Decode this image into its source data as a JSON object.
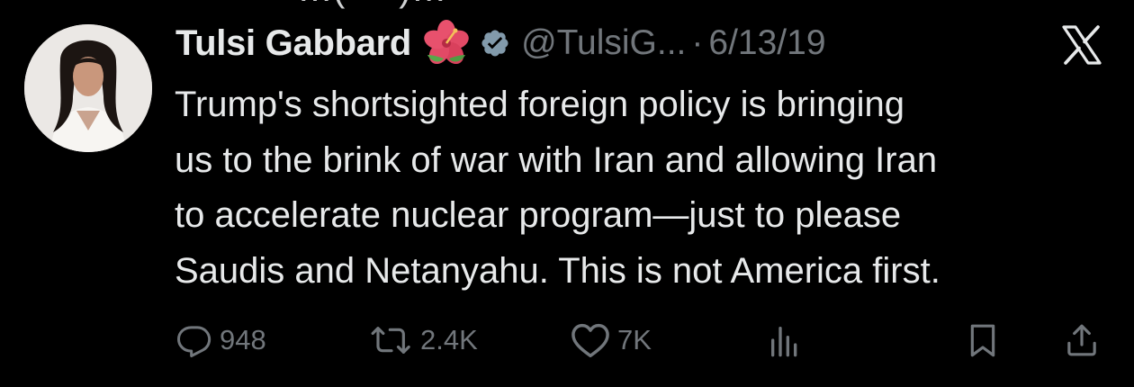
{
  "top_partial_text": "…( ˙ˑ˙ )…",
  "author": {
    "name": "Tulsi Gabbard",
    "emoji_icon": "hibiscus-icon",
    "verified_icon": "verified-badge-icon",
    "handle": "@TulsiG...",
    "separator": "·",
    "date": "6/13/19"
  },
  "tweet": {
    "lines": [
      "Trump's shortsighted foreign policy is bringing",
      "us to the brink of war with Iran and allowing Iran",
      "to accelerate nuclear program—just to please",
      "Saudis and Netanyahu. This is not America first."
    ]
  },
  "actions": {
    "replies": {
      "icon": "reply-icon",
      "count": "948"
    },
    "reposts": {
      "icon": "repost-icon",
      "count": "2.4K"
    },
    "likes": {
      "icon": "heart-icon",
      "count": "7K"
    },
    "views": {
      "icon": "views-icon"
    },
    "bookmark": {
      "icon": "bookmark-icon"
    },
    "share": {
      "icon": "share-icon"
    }
  },
  "logo_icon": "x-logo-icon",
  "colors": {
    "background": "#000000",
    "primary_text": "#e7e9ea",
    "secondary_text": "#71767b",
    "verified_badge": "#829aab"
  }
}
